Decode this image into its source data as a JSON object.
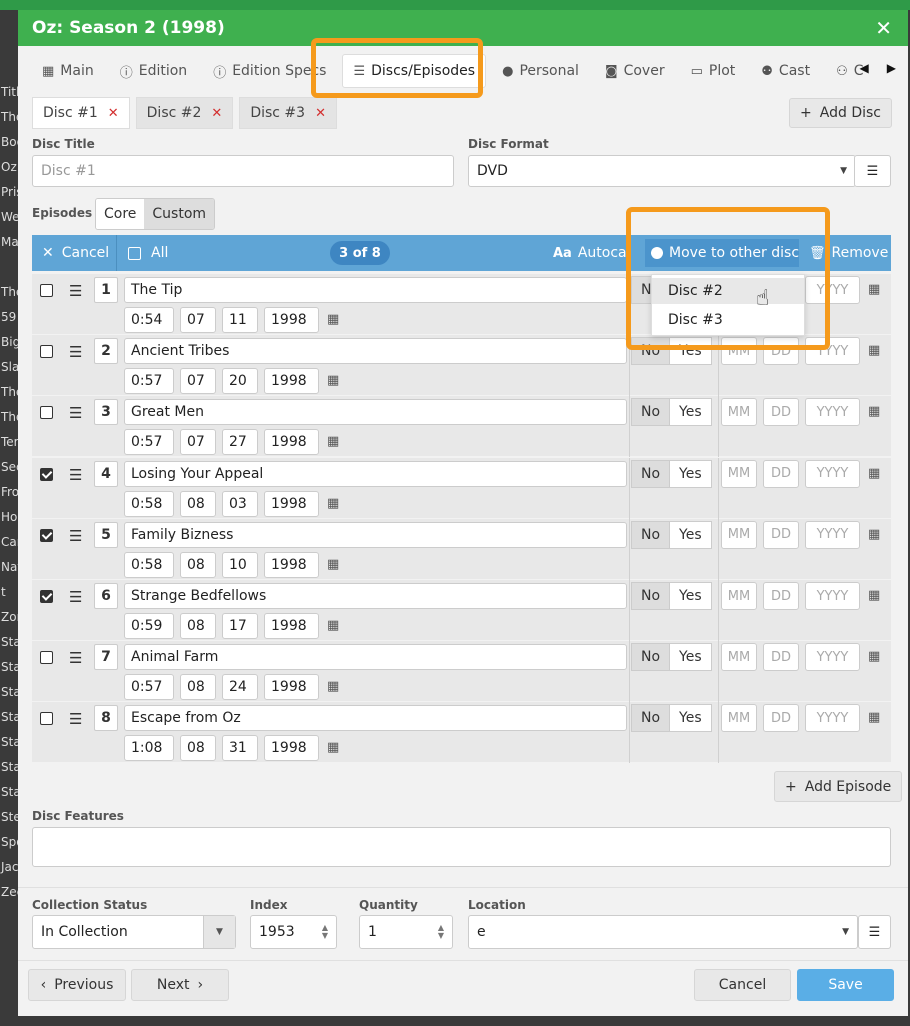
{
  "dialog": {
    "title": "Oz: Season 2 (1998)"
  },
  "background_list": [
    "Title",
    "The",
    "Boo",
    "Oz:",
    "Pris",
    "We",
    "Mad",
    "",
    "The",
    "59",
    "Big",
    "Slay",
    "The",
    "The",
    "Terr",
    "Sec",
    "Froz",
    "Hou",
    "Car",
    "Nat",
    "t",
    "Zon",
    "Sta",
    "Sta",
    "Sta",
    "Sta",
    "Sta",
    "Sta",
    "Sta",
    "Ste",
    "Spo",
    "Jac",
    "Zee"
  ],
  "tabs": [
    {
      "label": "Main",
      "icon": "film-icon"
    },
    {
      "label": "Edition",
      "icon": "info-icon"
    },
    {
      "label": "Edition Specs",
      "icon": "info-icon"
    },
    {
      "label": "Discs/Episodes",
      "icon": "list-icon"
    },
    {
      "label": "Personal",
      "icon": "person-icon"
    },
    {
      "label": "Cover",
      "icon": "camera-icon"
    },
    {
      "label": "Plot",
      "icon": "document-icon"
    },
    {
      "label": "Cast",
      "icon": "people-icon"
    },
    {
      "label": "C",
      "icon": "group-icon"
    }
  ],
  "disc_tabs": [
    {
      "label": "Disc #1",
      "active": true
    },
    {
      "label": "Disc #2",
      "active": false
    },
    {
      "label": "Disc #3",
      "active": false
    }
  ],
  "add_disc_label": "Add Disc",
  "disc_title": {
    "label": "Disc Title",
    "placeholder": "Disc #1"
  },
  "disc_format": {
    "label": "Disc Format",
    "value": "DVD"
  },
  "episodes_label": "Episodes",
  "episodes_mode": {
    "core": "Core",
    "custom": "Custom"
  },
  "toolbar": {
    "cancel": "Cancel",
    "all": "All",
    "count": "3 of 8",
    "autocomplete": "Autoca",
    "move": "Move to other disc",
    "remove": "Remove"
  },
  "move_menu": [
    "Disc #2",
    "Disc #3"
  ],
  "episodes": [
    {
      "num": "1",
      "title": "The Tip",
      "length": "0:54",
      "mm": "07",
      "dd": "11",
      "yyyy": "1998",
      "checked": false
    },
    {
      "num": "2",
      "title": "Ancient Tribes",
      "length": "0:57",
      "mm": "07",
      "dd": "20",
      "yyyy": "1998",
      "checked": false
    },
    {
      "num": "3",
      "title": "Great Men",
      "length": "0:57",
      "mm": "07",
      "dd": "27",
      "yyyy": "1998",
      "checked": false
    },
    {
      "num": "4",
      "title": "Losing Your Appeal",
      "length": "0:58",
      "mm": "08",
      "dd": "03",
      "yyyy": "1998",
      "checked": true
    },
    {
      "num": "5",
      "title": "Family Bizness",
      "length": "0:58",
      "mm": "08",
      "dd": "10",
      "yyyy": "1998",
      "checked": true
    },
    {
      "num": "6",
      "title": "Strange Bedfellows",
      "length": "0:59",
      "mm": "08",
      "dd": "17",
      "yyyy": "1998",
      "checked": true
    },
    {
      "num": "7",
      "title": "Animal Farm",
      "length": "0:57",
      "mm": "08",
      "dd": "24",
      "yyyy": "1998",
      "checked": false
    },
    {
      "num": "8",
      "title": "Escape from Oz",
      "length": "1:08",
      "mm": "08",
      "dd": "31",
      "yyyy": "1998",
      "checked": false
    }
  ],
  "seen": {
    "no": "No",
    "yes": "Yes",
    "mm": "MM",
    "dd": "DD",
    "yyyy": "YYYY"
  },
  "add_episode_label": "Add Episode",
  "disc_features_label": "Disc Features",
  "collection_status": {
    "label": "Collection Status",
    "value": "In Collection"
  },
  "index": {
    "label": "Index",
    "value": "1953"
  },
  "quantity": {
    "label": "Quantity",
    "value": "1"
  },
  "location": {
    "label": "Location",
    "value": "e"
  },
  "footer": {
    "previous": "Previous",
    "next": "Next",
    "cancel": "Cancel",
    "save": "Save"
  },
  "colors": {
    "header_green": "#3fb04f",
    "toolbar_blue": "#5fa5d6",
    "highlight_orange": "#f59a1c",
    "save_blue": "#5aaee6"
  }
}
